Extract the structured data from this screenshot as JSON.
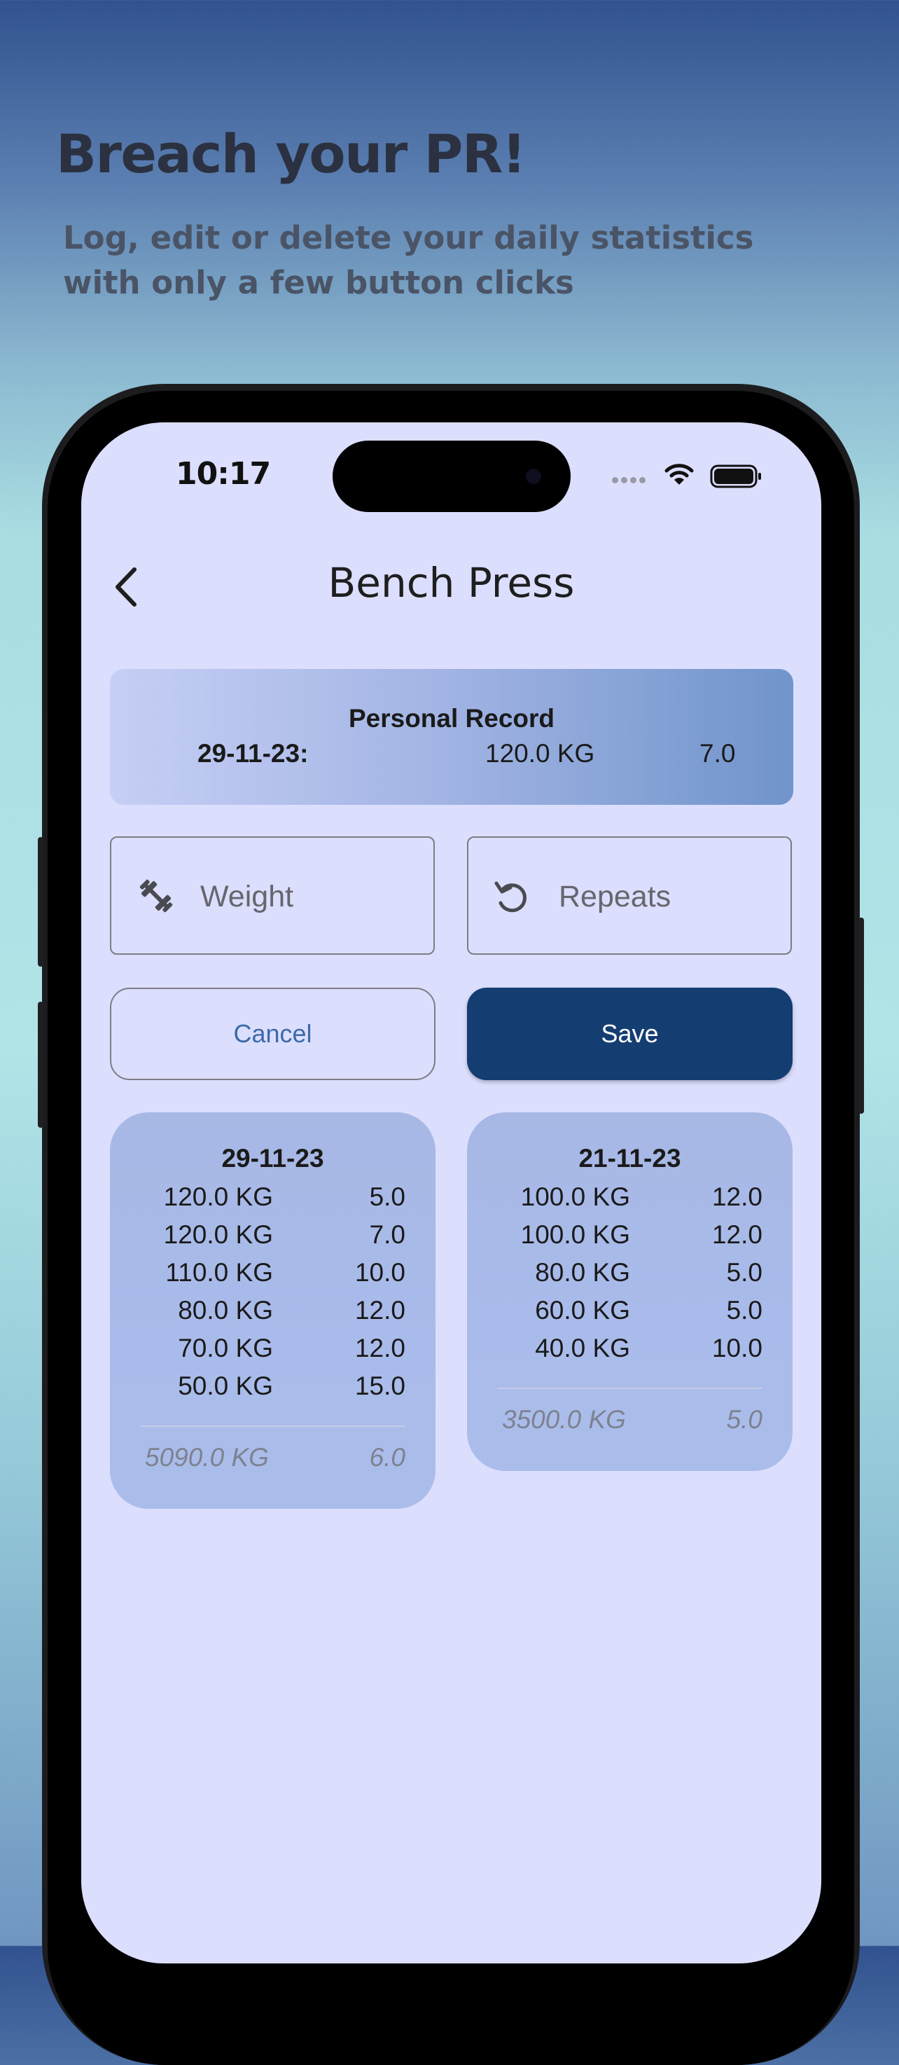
{
  "promo": {
    "headline": "Breach your PR!",
    "subline_1": "Log, edit or delete your daily statistics",
    "subline_2": "with only a few button clicks"
  },
  "status_bar": {
    "time": "10:17"
  },
  "header": {
    "title": "Bench Press"
  },
  "personal_record": {
    "title": "Personal Record",
    "date": "29-11-23:",
    "weight": "120.0 KG",
    "reps": "7.0"
  },
  "inputs": {
    "weight_placeholder": "Weight",
    "repeats_placeholder": "Repeats"
  },
  "actions": {
    "cancel_label": "Cancel",
    "save_label": "Save"
  },
  "logs": [
    {
      "date": "29-11-23",
      "sets": [
        {
          "weight": "120.0 KG",
          "reps": "5.0"
        },
        {
          "weight": "120.0 KG",
          "reps": "7.0"
        },
        {
          "weight": "110.0 KG",
          "reps": "10.0"
        },
        {
          "weight": "80.0 KG",
          "reps": "12.0"
        },
        {
          "weight": "70.0 KG",
          "reps": "12.0"
        },
        {
          "weight": "50.0 KG",
          "reps": "15.0"
        }
      ],
      "total_weight": "5090.0 KG",
      "total_reps": "6.0"
    },
    {
      "date": "21-11-23",
      "sets": [
        {
          "weight": "100.0 KG",
          "reps": "12.0"
        },
        {
          "weight": "100.0 KG",
          "reps": "12.0"
        },
        {
          "weight": "80.0 KG",
          "reps": "5.0"
        },
        {
          "weight": "60.0 KG",
          "reps": "5.0"
        },
        {
          "weight": "40.0 KG",
          "reps": "10.0"
        }
      ],
      "total_weight": "3500.0 KG",
      "total_reps": "5.0"
    }
  ],
  "colors": {
    "screen_bg": "#dcdefe",
    "save_button": "#143d72",
    "cancel_text": "#3b6aa8",
    "card": "#a9bbea"
  },
  "icons": {
    "back": "chevron-left-icon",
    "weight": "dumbbell-icon",
    "repeats": "rotate-ccw-icon",
    "wifi": "wifi-icon",
    "battery": "battery-icon"
  }
}
